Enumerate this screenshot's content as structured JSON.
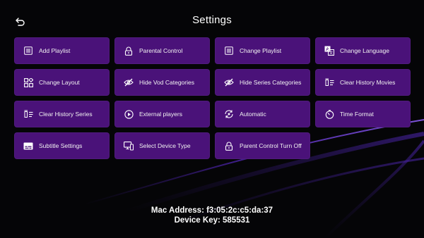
{
  "header": {
    "title": "Settings",
    "back_icon": "back-arrow-icon"
  },
  "tiles": [
    {
      "label": "Add Playlist",
      "icon": "list-icon"
    },
    {
      "label": "Parental Control",
      "icon": "lock-icon"
    },
    {
      "label": "Change Playlist",
      "icon": "list-icon"
    },
    {
      "label": "Change Language",
      "icon": "translate-icon"
    },
    {
      "label": "Change Layout",
      "icon": "layout-icon"
    },
    {
      "label": "Hide Vod Categories",
      "icon": "eye-off-icon"
    },
    {
      "label": "Hide Series Categories",
      "icon": "eye-off-icon"
    },
    {
      "label": "Clear History Movies",
      "icon": "clear-list-icon"
    },
    {
      "label": "Clear History Series",
      "icon": "clear-list-icon"
    },
    {
      "label": "External players",
      "icon": "play-circle-icon"
    },
    {
      "label": "Automatic",
      "icon": "auto-refresh-icon"
    },
    {
      "label": "Time Format",
      "icon": "timer-icon"
    },
    {
      "label": "Subtitle Settings",
      "icon": "subtitles-icon"
    },
    {
      "label": "Select Device Type",
      "icon": "device-icon"
    },
    {
      "label": "Parent Control Turn Off",
      "icon": "lock-icon"
    }
  ],
  "footer": {
    "mac_address": "Mac Address: f3:05:2c:c5:da:37",
    "device_key": "Device Key: 585531"
  },
  "colors": {
    "tile_bg": "#4a1279",
    "background": "#050507",
    "accent_swoosh": "#6b2fd6"
  }
}
